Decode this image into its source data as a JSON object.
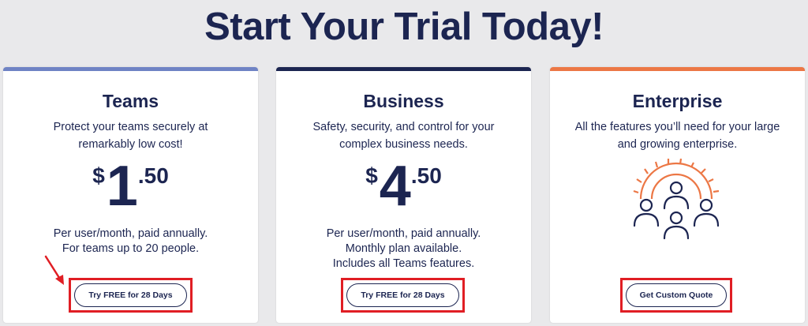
{
  "page": {
    "title": "Start Your Trial Today!"
  },
  "plans": {
    "teams": {
      "name": "Teams",
      "description": "Protect your teams securely at remarkably low cost!",
      "price_currency": "$",
      "price_whole": "1",
      "price_cents": ".50",
      "notes": [
        "Per user/month, paid annually.",
        "For teams up to 20 people."
      ],
      "cta_label": "Try FREE for 28 Days",
      "accent_color": "#6f83c4"
    },
    "business": {
      "name": "Business",
      "description": "Safety, security, and control for your complex business needs.",
      "price_currency": "$",
      "price_whole": "4",
      "price_cents": ".50",
      "notes": [
        "Per user/month, paid annually.",
        "Monthly plan available.",
        "Includes all Teams features."
      ],
      "cta_label": "Try FREE for 28 Days",
      "accent_color": "#1c2551"
    },
    "enterprise": {
      "name": "Enterprise",
      "description": "All the features you’ll need for your large and growing enterprise.",
      "icon": "team-gear-icon",
      "cta_label": "Get Custom Quote",
      "accent_color": "#ec7745"
    }
  },
  "annotations": {
    "highlight_color": "#e01e24",
    "arrow_icon": "red-arrow-icon"
  }
}
